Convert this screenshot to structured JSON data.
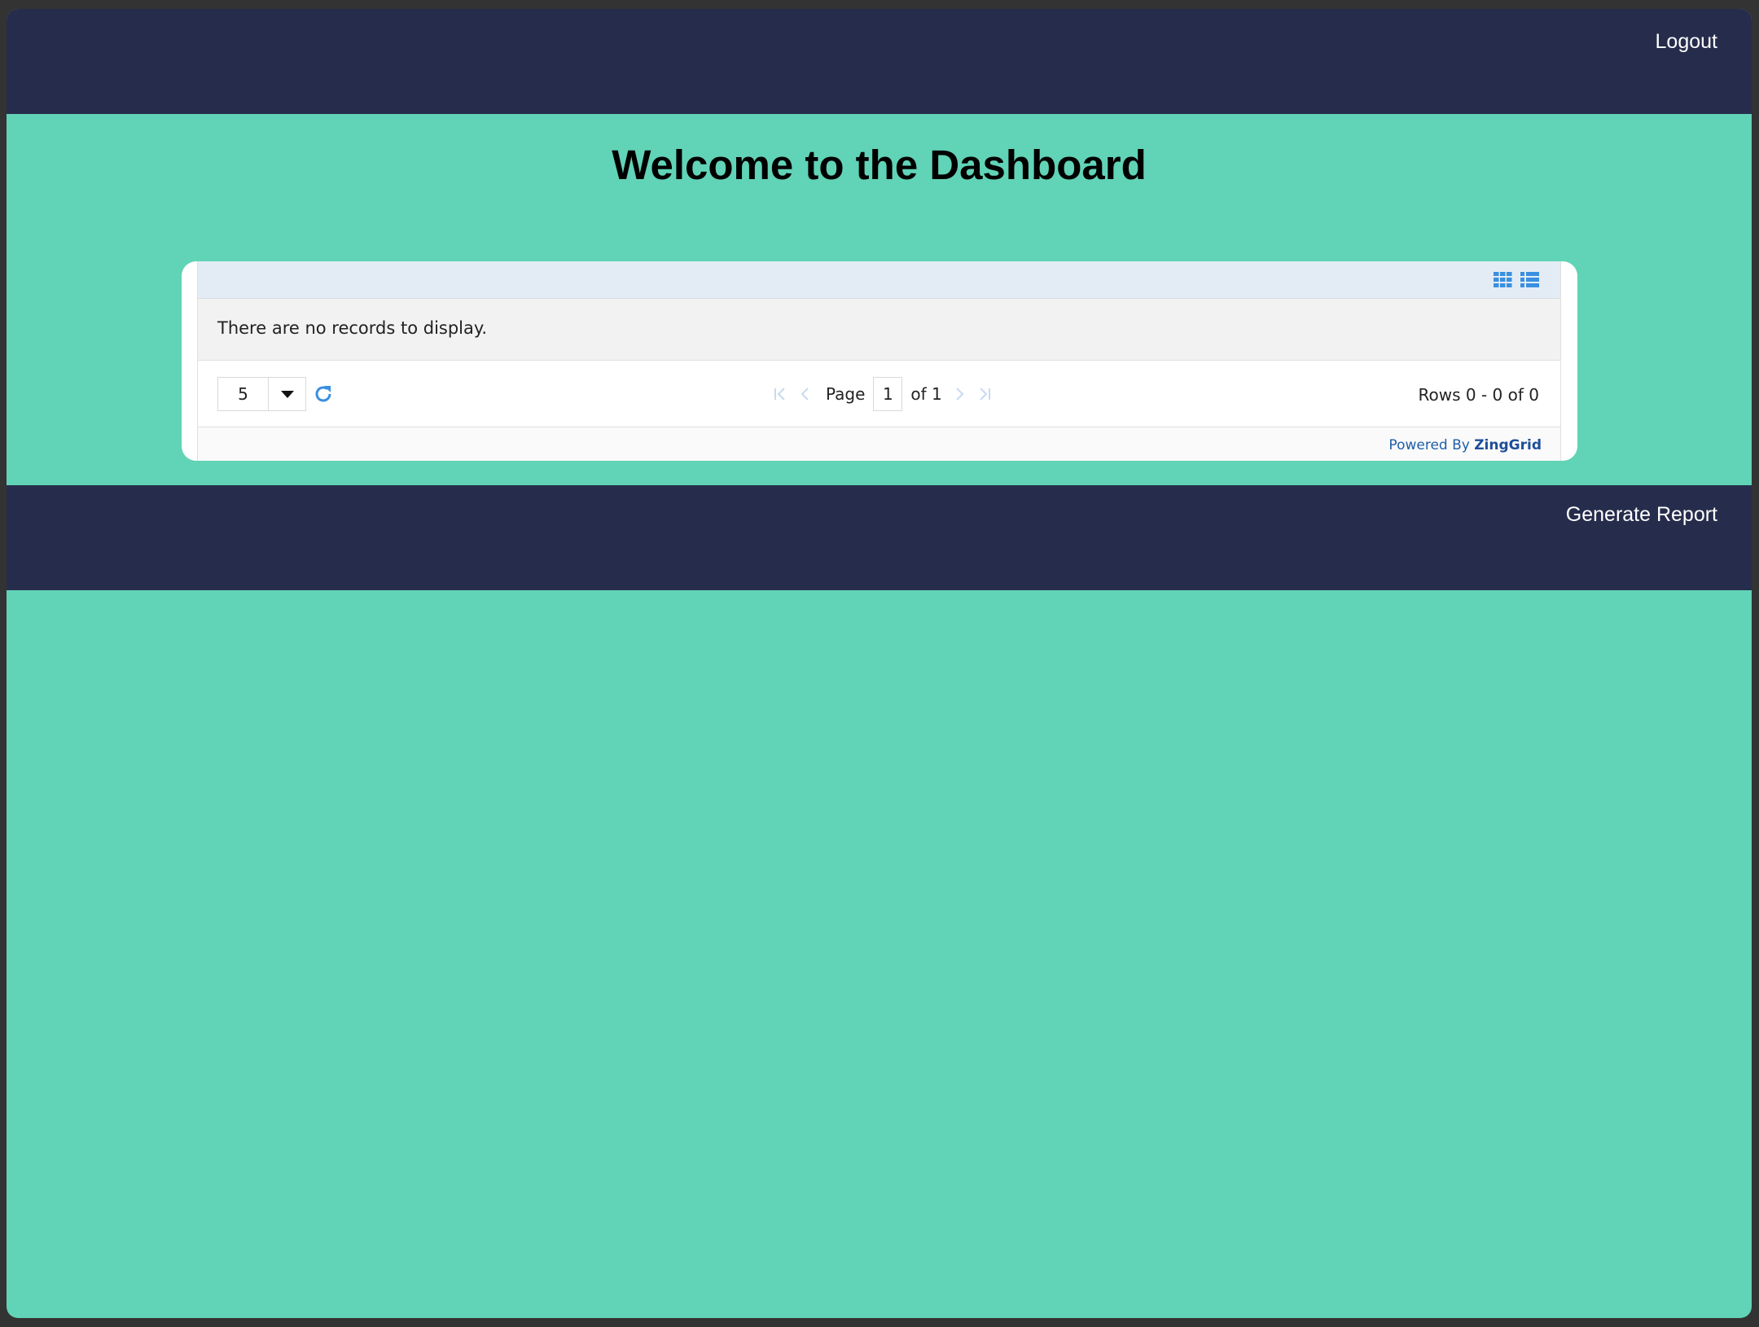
{
  "header": {
    "logout_label": "Logout"
  },
  "main": {
    "title": "Welcome to the Dashboard"
  },
  "grid": {
    "view_icons": [
      "grid-view-icon",
      "list-view-icon"
    ],
    "empty_message": "There are no records to display.",
    "page_size": "5",
    "page_label": "Page",
    "current_page": "1",
    "of_label": "of 1",
    "rows_info": "Rows 0 - 0 of 0",
    "powered_by_prefix": "Powered By",
    "powered_by_brand": "ZingGrid"
  },
  "footer": {
    "generate_report_label": "Generate Report"
  },
  "colors": {
    "bar_background": "#262d4c",
    "page_background": "#61d3b7",
    "accent_blue": "#3a8fe0"
  }
}
